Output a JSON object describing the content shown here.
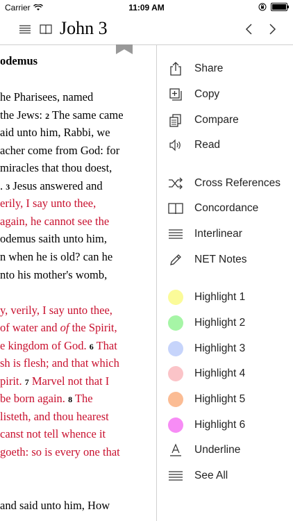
{
  "status": {
    "carrier": "Carrier",
    "time": "11:09 AM"
  },
  "nav": {
    "title": "John 3"
  },
  "text": {
    "heading": "odemus",
    "lines": [
      {
        "segs": [
          {
            "t": "he Pharisees, named",
            "red": false
          }
        ]
      },
      {
        "segs": [
          {
            "t": "the Jews: ",
            "red": false
          },
          {
            "t": "2",
            "v": true
          },
          {
            "t": " The same came",
            "red": false
          }
        ]
      },
      {
        "segs": [
          {
            "t": "aid unto him, Rabbi, we",
            "red": false
          }
        ]
      },
      {
        "segs": [
          {
            "t": "acher come from God: for",
            "red": false
          }
        ]
      },
      {
        "segs": [
          {
            "t": "miracles that thou doest,",
            "red": false
          }
        ]
      },
      {
        "segs": [
          {
            "t": ". ",
            "red": false
          },
          {
            "t": "3",
            "v": true
          },
          {
            "t": " Jesus answered and",
            "red": false
          }
        ]
      },
      {
        "segs": [
          {
            "t": "erily, I say unto thee,",
            "red": true
          }
        ]
      },
      {
        "segs": [
          {
            "t": "again, he cannot see the",
            "red": true
          }
        ]
      },
      {
        "segs": [
          {
            "t": "odemus saith unto him,",
            "red": false
          }
        ]
      },
      {
        "segs": [
          {
            "t": "n when he is old? can he",
            "red": false
          }
        ]
      },
      {
        "segs": [
          {
            "t": "nto his mother's womb,",
            "red": false
          }
        ]
      },
      {
        "segs": []
      },
      {
        "segs": [
          {
            "t": "y, verily, I say unto thee,",
            "red": true
          }
        ]
      },
      {
        "segs": [
          {
            "t": "of water and ",
            "red": true
          },
          {
            "t": "of",
            "red": true,
            "i": true
          },
          {
            "t": " the Spirit,",
            "red": true
          }
        ]
      },
      {
        "segs": [
          {
            "t": "e kingdom of God. ",
            "red": true
          },
          {
            "t": "6",
            "v": true
          },
          {
            "t": " That",
            "red": true
          }
        ]
      },
      {
        "segs": [
          {
            "t": "sh is flesh; and that which",
            "red": true
          }
        ]
      },
      {
        "segs": [
          {
            "t": "pirit. ",
            "red": true
          },
          {
            "t": "7",
            "v": true
          },
          {
            "t": " Marvel not that I",
            "red": true
          }
        ]
      },
      {
        "segs": [
          {
            "t": " be born again. ",
            "red": true
          },
          {
            "t": "8",
            "v": true
          },
          {
            "t": " The",
            "red": true
          }
        ]
      },
      {
        "segs": [
          {
            "t": "listeth, and thou hearest",
            "red": true
          }
        ]
      },
      {
        "segs": [
          {
            "t": "canst not tell whence it",
            "red": true
          }
        ]
      },
      {
        "segs": [
          {
            "t": "goeth: so is every one that",
            "red": true
          }
        ]
      },
      {
        "segs": []
      },
      {
        "segs": []
      },
      {
        "segs": [
          {
            "t": "and said unto him, How",
            "red": false
          }
        ]
      }
    ]
  },
  "menu": {
    "items": [
      {
        "name": "share",
        "label": "Share",
        "icon": "share-icon"
      },
      {
        "name": "copy",
        "label": "Copy",
        "icon": "copy-icon"
      },
      {
        "name": "compare",
        "label": "Compare",
        "icon": "compare-icon"
      },
      {
        "name": "read",
        "label": "Read",
        "icon": "speaker-icon"
      },
      {
        "name": "cross-references",
        "label": "Cross References",
        "icon": "shuffle-icon"
      },
      {
        "name": "concordance",
        "label": "Concordance",
        "icon": "book-icon"
      },
      {
        "name": "interlinear",
        "label": "Interlinear",
        "icon": "lines-icon"
      },
      {
        "name": "net-notes",
        "label": "NET Notes",
        "icon": "pencil-icon"
      },
      {
        "name": "highlight-1",
        "label": "Highlight 1",
        "color": "#fbfb99"
      },
      {
        "name": "highlight-2",
        "label": "Highlight 2",
        "color": "#a6f5a6"
      },
      {
        "name": "highlight-3",
        "label": "Highlight 3",
        "color": "#c6d4fb"
      },
      {
        "name": "highlight-4",
        "label": "Highlight 4",
        "color": "#fbc4c8"
      },
      {
        "name": "highlight-5",
        "label": "Highlight 5",
        "color": "#fbbc94"
      },
      {
        "name": "highlight-6",
        "label": "Highlight 6",
        "color": "#f78cf5"
      },
      {
        "name": "underline",
        "label": "Underline",
        "icon": "underline-icon"
      },
      {
        "name": "see-all",
        "label": "See All",
        "icon": "lines-icon"
      }
    ]
  }
}
